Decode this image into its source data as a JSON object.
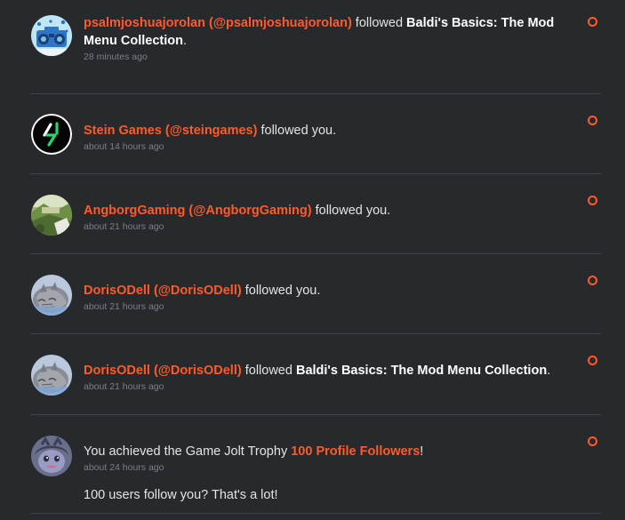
{
  "notifications": [
    {
      "user": "psalmjoshuajorolan (@psalmjoshuajorolan)",
      "action": " followed ",
      "target": "Baldi's Basics: The Mod Menu Collection",
      "end": ".",
      "time": "28 minutes ago"
    },
    {
      "user": "Stein Games (@steingames)",
      "action": " followed you.",
      "time": "about 14 hours ago"
    },
    {
      "user": "AngborgGaming (@AngborgGaming)",
      "action": " followed you.",
      "time": "about 21 hours ago"
    },
    {
      "user": "DorisODell (@DorisODell)",
      "action": " followed you.",
      "time": "about 21 hours ago"
    },
    {
      "user": "DorisODell (@DorisODell)",
      "action": " followed ",
      "target": "Baldi's Basics: The Mod Menu Collection",
      "end": ".",
      "time": "about 21 hours ago"
    },
    {
      "prefix": "You achieved the Game Jolt Trophy ",
      "trophy": "100 Profile Followers",
      "end": "!",
      "time": "about 24 hours ago",
      "description": "100 users follow you? That's a lot!"
    }
  ],
  "colors": {
    "background": "#27292c",
    "accent": "#ff5a28",
    "text": "#e4e4e4",
    "muted": "#7c7f84",
    "divider": "#3f4246"
  }
}
